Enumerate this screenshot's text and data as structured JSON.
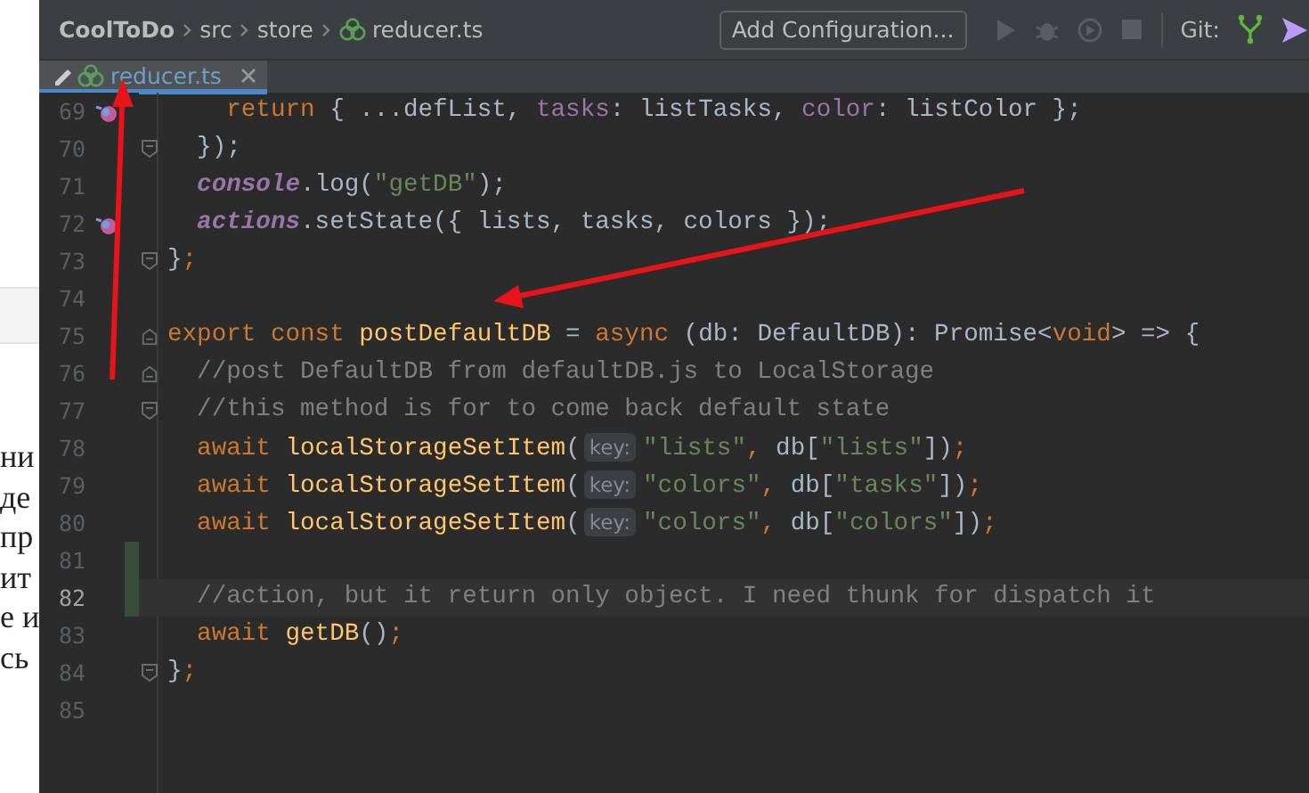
{
  "background_page": {
    "lines": [
      "ни",
      "де",
      "пр",
      "ит",
      "е и",
      "сь"
    ]
  },
  "toolbar": {
    "breadcrumbs": [
      {
        "label": "CoolToDo",
        "kind": "project"
      },
      {
        "label": "src",
        "kind": "folder"
      },
      {
        "label": "store",
        "kind": "folder"
      },
      {
        "label": "reducer.ts",
        "kind": "file"
      }
    ],
    "config_button": "Add Configuration...",
    "git_label": "Git:"
  },
  "tabs": [
    {
      "label": "reducer.ts",
      "selected": true,
      "modified": true
    }
  ],
  "editor": {
    "lines": [
      {
        "number": "69",
        "override_marker": true,
        "fold_start": false,
        "fold_end": false,
        "changed": false,
        "current": false,
        "tokens": [
          {
            "text": "    return",
            "kind": "keyword"
          },
          {
            "text": " { ...defList, ",
            "kind": "plain"
          },
          {
            "text": "tasks",
            "kind": "property"
          },
          {
            "text": ": listTasks, ",
            "kind": "plain"
          },
          {
            "text": "color",
            "kind": "property"
          },
          {
            "text": ": listColor };",
            "kind": "plain"
          }
        ]
      },
      {
        "number": "70",
        "override_marker": false,
        "fold_start": false,
        "fold_end": true,
        "changed": false,
        "current": false,
        "tokens": [
          {
            "text": "  });",
            "kind": "plain"
          }
        ]
      },
      {
        "number": "71",
        "override_marker": false,
        "fold_start": false,
        "fold_end": false,
        "changed": false,
        "current": false,
        "tokens": [
          {
            "text": "  console",
            "kind": "global"
          },
          {
            "text": ".log(",
            "kind": "plain"
          },
          {
            "text": "\"getDB\"",
            "kind": "string"
          },
          {
            "text": ");",
            "kind": "plain"
          }
        ]
      },
      {
        "number": "72",
        "override_marker": true,
        "fold_start": false,
        "fold_end": false,
        "changed": false,
        "current": false,
        "tokens": [
          {
            "text": "  actions",
            "kind": "global"
          },
          {
            "text": ".setState({ lists, tasks, colors });",
            "kind": "plain"
          }
        ]
      },
      {
        "number": "73",
        "override_marker": false,
        "fold_start": false,
        "fold_end": true,
        "changed": false,
        "current": false,
        "tokens": [
          {
            "text": "}",
            "kind": "plain"
          },
          {
            "text": ";",
            "kind": "keyword"
          }
        ]
      },
      {
        "number": "74",
        "override_marker": false,
        "fold_start": false,
        "fold_end": false,
        "changed": false,
        "current": false
      },
      {
        "number": "75",
        "override_marker": false,
        "fold_start": true,
        "fold_end": false,
        "changed": false,
        "current": false,
        "tokens": [
          {
            "text": "export const ",
            "kind": "keyword"
          },
          {
            "text": "postDefaultDB",
            "kind": "function"
          },
          {
            "text": " = ",
            "kind": "plain"
          },
          {
            "text": "async",
            "kind": "keyword"
          },
          {
            "text": " (db: DefaultDB): Promise<",
            "kind": "plain"
          },
          {
            "text": "void",
            "kind": "keyword"
          },
          {
            "text": "> => {",
            "kind": "plain"
          }
        ]
      },
      {
        "number": "76",
        "override_marker": false,
        "fold_start": true,
        "fold_end": false,
        "changed": false,
        "current": false,
        "tokens": [
          {
            "text": "  //post DefaultDB from defaultDB.js to LocalStorage",
            "kind": "comment"
          }
        ]
      },
      {
        "number": "77",
        "override_marker": false,
        "fold_start": false,
        "fold_end": true,
        "changed": false,
        "current": false,
        "tokens": [
          {
            "text": "  //this method is for to come back default state",
            "kind": "comment"
          }
        ]
      },
      {
        "number": "78",
        "override_marker": false,
        "fold_start": false,
        "fold_end": false,
        "changed": false,
        "current": false,
        "tokens": [
          {
            "text": "  await ",
            "kind": "keyword"
          },
          {
            "text": "localStorageSetItem",
            "kind": "function"
          },
          {
            "text": "(",
            "kind": "plain"
          },
          {
            "text": "key:",
            "kind": "hint"
          },
          {
            "text": "\"lists\"",
            "kind": "string"
          },
          {
            "text": ",",
            "kind": "keyword"
          },
          {
            "text": " db[",
            "kind": "plain"
          },
          {
            "text": "\"lists\"",
            "kind": "string"
          },
          {
            "text": "])",
            "kind": "plain"
          },
          {
            "text": ";",
            "kind": "keyword"
          }
        ]
      },
      {
        "number": "79",
        "override_marker": false,
        "fold_start": false,
        "fold_end": false,
        "changed": false,
        "current": false,
        "tokens": [
          {
            "text": "  await ",
            "kind": "keyword"
          },
          {
            "text": "localStorageSetItem",
            "kind": "function"
          },
          {
            "text": "(",
            "kind": "plain"
          },
          {
            "text": "key:",
            "kind": "hint"
          },
          {
            "text": "\"colors\"",
            "kind": "string"
          },
          {
            "text": ",",
            "kind": "keyword"
          },
          {
            "text": " db[",
            "kind": "plain"
          },
          {
            "text": "\"tasks\"",
            "kind": "string"
          },
          {
            "text": "])",
            "kind": "plain"
          },
          {
            "text": ";",
            "kind": "keyword"
          }
        ]
      },
      {
        "number": "80",
        "override_marker": false,
        "fold_start": false,
        "fold_end": false,
        "changed": false,
        "current": false,
        "tokens": [
          {
            "text": "  await ",
            "kind": "keyword"
          },
          {
            "text": "localStorageSetItem",
            "kind": "function"
          },
          {
            "text": "(",
            "kind": "plain"
          },
          {
            "text": "key:",
            "kind": "hint"
          },
          {
            "text": "\"colors\"",
            "kind": "string"
          },
          {
            "text": ",",
            "kind": "keyword"
          },
          {
            "text": " db[",
            "kind": "plain"
          },
          {
            "text": "\"colors\"",
            "kind": "string"
          },
          {
            "text": "])",
            "kind": "plain"
          },
          {
            "text": ";",
            "kind": "keyword"
          }
        ]
      },
      {
        "number": "81",
        "override_marker": false,
        "fold_start": false,
        "fold_end": false,
        "changed": true,
        "current": false
      },
      {
        "number": "82",
        "override_marker": false,
        "fold_start": false,
        "fold_end": false,
        "changed": true,
        "current": true,
        "tokens": [
          {
            "text": "  //action, but it return only object. I need thunk for dispatch it",
            "kind": "comment"
          }
        ]
      },
      {
        "number": "83",
        "override_marker": false,
        "fold_start": false,
        "fold_end": false,
        "changed": false,
        "current": false,
        "tokens": [
          {
            "text": "  await ",
            "kind": "keyword"
          },
          {
            "text": "getDB",
            "kind": "function"
          },
          {
            "text": "()",
            "kind": "plain"
          },
          {
            "text": ";",
            "kind": "keyword"
          }
        ]
      },
      {
        "number": "84",
        "override_marker": false,
        "fold_start": false,
        "fold_end": true,
        "changed": false,
        "current": false,
        "tokens": [
          {
            "text": "}",
            "kind": "plain"
          },
          {
            "text": ";",
            "kind": "keyword"
          }
        ]
      },
      {
        "number": "85",
        "override_marker": false,
        "fold_start": false,
        "fold_end": false,
        "changed": false,
        "current": false
      }
    ]
  },
  "annotations": [
    {
      "kind": "arrow"
    },
    {
      "kind": "arrow"
    }
  ]
}
